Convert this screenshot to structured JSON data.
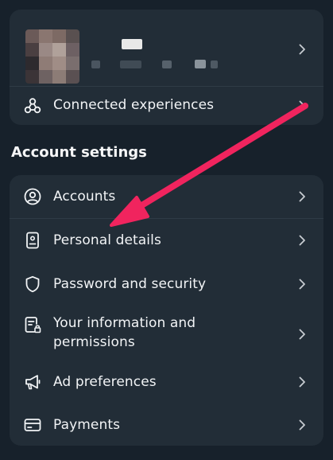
{
  "profile": {
    "avatar_pixels": [
      "#6b5a58",
      "#8a7670",
      "#7d6a64",
      "#595050",
      "#4a3f41",
      "#9a8985",
      "#b0a19a",
      "#6d6063",
      "#2d2a2e",
      "#8f7c76",
      "#a08d86",
      "#7a6e6e",
      "#3b3437",
      "#6e6262",
      "#8c7c76",
      "#5a5052"
    ],
    "connected_label": "Connected experiences"
  },
  "section": {
    "title": "Account settings"
  },
  "settings_items": [
    {
      "id": "accounts",
      "label": "Accounts",
      "icon": "user-circle-icon"
    },
    {
      "id": "personal-details",
      "label": "Personal details",
      "icon": "id-card-icon"
    },
    {
      "id": "password-security",
      "label": "Password and security",
      "icon": "shield-icon"
    },
    {
      "id": "your-information",
      "label_line1": "Your information and",
      "label_line2": "permissions",
      "icon": "document-lock-icon"
    },
    {
      "id": "ad-preferences",
      "label": "Ad preferences",
      "icon": "megaphone-icon"
    },
    {
      "id": "payments",
      "label": "Payments",
      "icon": "credit-card-icon"
    }
  ],
  "colors": {
    "background": "#17212b",
    "card": "#222d37",
    "divider": "#2f3b46",
    "annotation_arrow": "#f0245e"
  }
}
